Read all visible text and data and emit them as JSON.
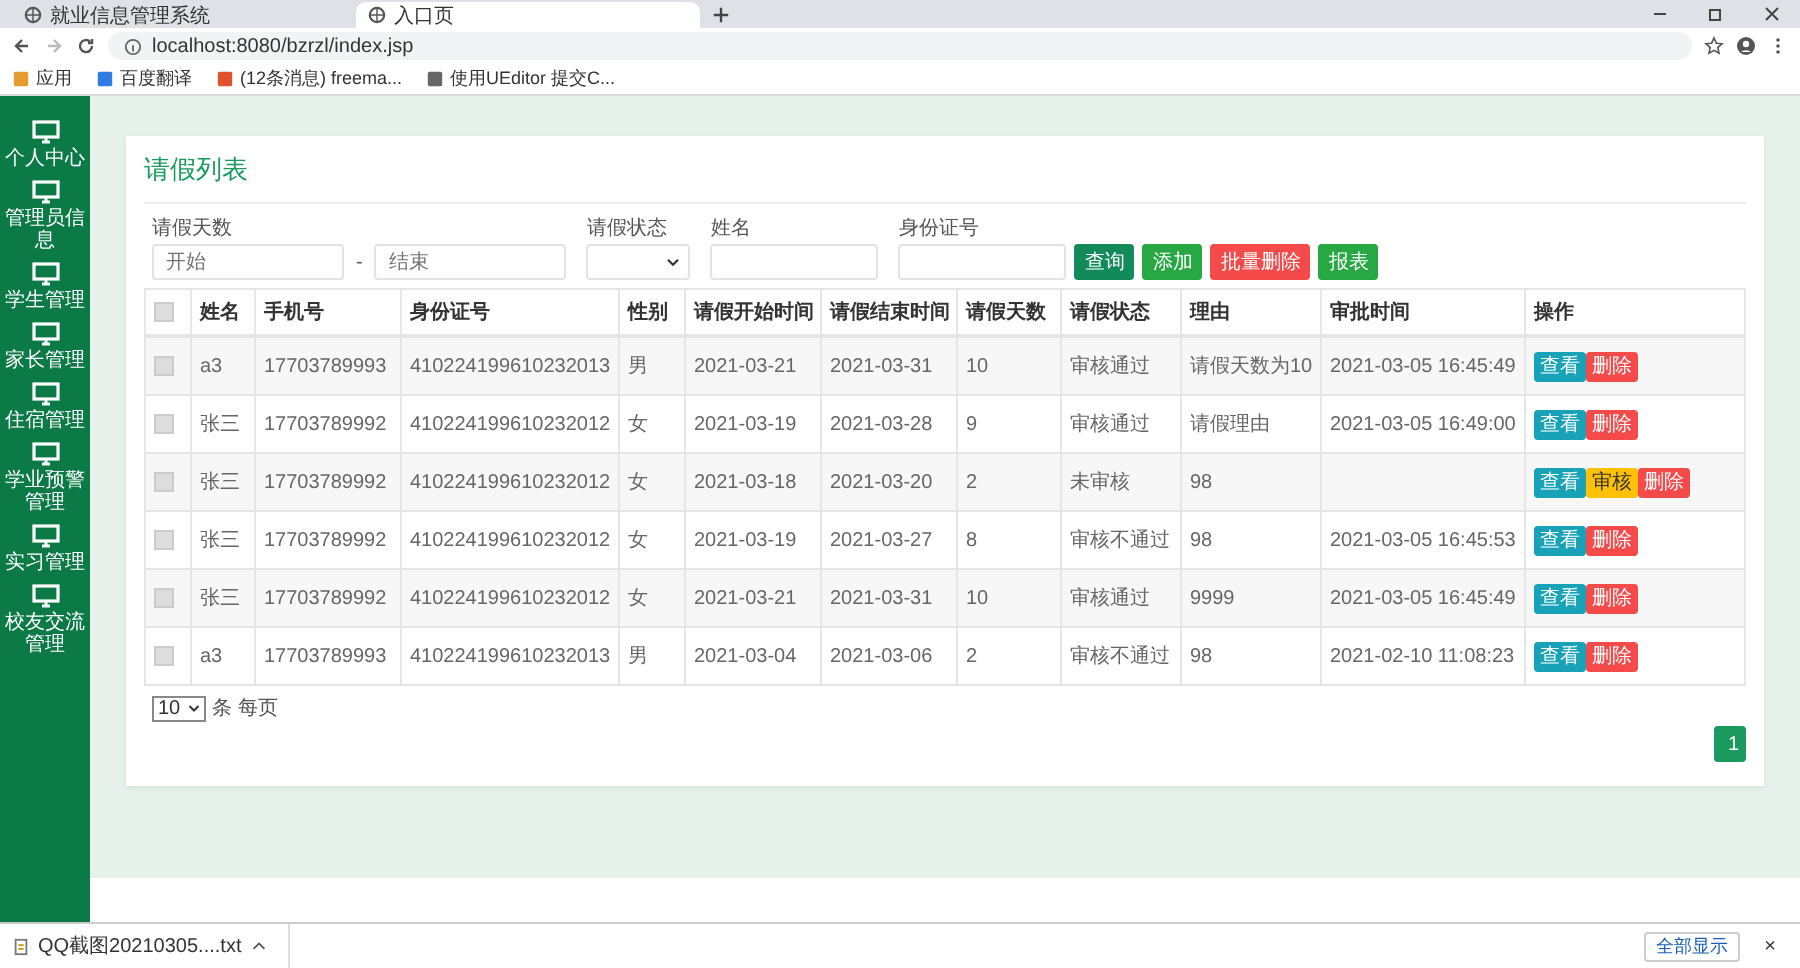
{
  "browser": {
    "tabs": [
      {
        "title": "就业信息管理系统",
        "selected": false
      },
      {
        "title": "入口页",
        "selected": true
      }
    ],
    "url": "localhost:8080/bzrzl/index.jsp",
    "bookmarks": [
      "应用",
      "百度翻译",
      "(12条消息) freema...",
      "使用UEditor 提交C..."
    ]
  },
  "sidebar": {
    "items": [
      "个人中心",
      "管理员信息",
      "学生管理",
      "家长管理",
      "住宿管理",
      "学业预警管理",
      "实习管理",
      "校友交流管理"
    ]
  },
  "panel": {
    "title": "请假列表",
    "filters": {
      "days_label": "请假天数",
      "start_placeholder": "开始",
      "separator": "-",
      "end_placeholder": "结束",
      "status_label": "请假状态",
      "name_label": "姓名",
      "id_label": "身份证号"
    },
    "actions": [
      {
        "label": "查询",
        "kind": "query"
      },
      {
        "label": "添加",
        "kind": "add"
      },
      {
        "label": "批量删除",
        "kind": "delete"
      },
      {
        "label": "报表",
        "kind": "report"
      }
    ],
    "table": {
      "select_all_checked": false,
      "columns": [
        "姓名",
        "手机号",
        "身份证号",
        "性别",
        "请假开始时间",
        "请假结束时间",
        "请假天数",
        "请假状态",
        "理由",
        "审批时间",
        "操作"
      ],
      "rows": [
        {
          "checked": false,
          "cells": [
            "a3",
            "17703789993",
            "410224199610232013",
            "男",
            "2021-03-21",
            "2021-03-31",
            "10",
            "审核通过",
            "请假天数为10",
            "2021-03-05 16:45:49"
          ],
          "buttons": [
            {
              "label": "查看",
              "kind": "view"
            },
            {
              "label": "删除",
              "kind": "delete"
            }
          ]
        },
        {
          "checked": false,
          "cells": [
            "张三",
            "17703789992",
            "410224199610232012",
            "女",
            "2021-03-19",
            "2021-03-28",
            "9",
            "审核通过",
            "请假理由",
            "2021-03-05 16:49:00"
          ],
          "buttons": [
            {
              "label": "查看",
              "kind": "view"
            },
            {
              "label": "删除",
              "kind": "delete"
            }
          ]
        },
        {
          "checked": false,
          "cells": [
            "张三",
            "17703789992",
            "410224199610232012",
            "女",
            "2021-03-18",
            "2021-03-20",
            "2",
            "未审核",
            "98",
            ""
          ],
          "buttons": [
            {
              "label": "查看",
              "kind": "view"
            },
            {
              "label": "审核",
              "kind": "review"
            },
            {
              "label": "删除",
              "kind": "delete"
            }
          ]
        },
        {
          "checked": false,
          "cells": [
            "张三",
            "17703789992",
            "410224199610232012",
            "女",
            "2021-03-19",
            "2021-03-27",
            "8",
            "审核不通过",
            "98",
            "2021-03-05 16:45:53"
          ],
          "buttons": [
            {
              "label": "查看",
              "kind": "view"
            },
            {
              "label": "删除",
              "kind": "delete"
            }
          ]
        },
        {
          "checked": false,
          "cells": [
            "张三",
            "17703789992",
            "410224199610232012",
            "女",
            "2021-03-21",
            "2021-03-31",
            "10",
            "审核通过",
            "9999",
            "2021-03-05 16:45:49"
          ],
          "buttons": [
            {
              "label": "查看",
              "kind": "view"
            },
            {
              "label": "删除",
              "kind": "delete"
            }
          ]
        },
        {
          "checked": false,
          "cells": [
            "a3",
            "17703789993",
            "410224199610232013",
            "男",
            "2021-03-04",
            "2021-03-06",
            "2",
            "审核不通过",
            "98",
            "2021-02-10 11:08:23"
          ],
          "buttons": [
            {
              "label": "查看",
              "kind": "view"
            },
            {
              "label": "删除",
              "kind": "delete"
            }
          ]
        }
      ]
    },
    "page_size": "10",
    "page_size_suffix": "条 每页",
    "pages": [
      {
        "label": "1",
        "selected": true
      }
    ]
  },
  "downloads": {
    "file": "QQ截图20210305....txt",
    "show_all": "全部显示",
    "close": "×"
  }
}
